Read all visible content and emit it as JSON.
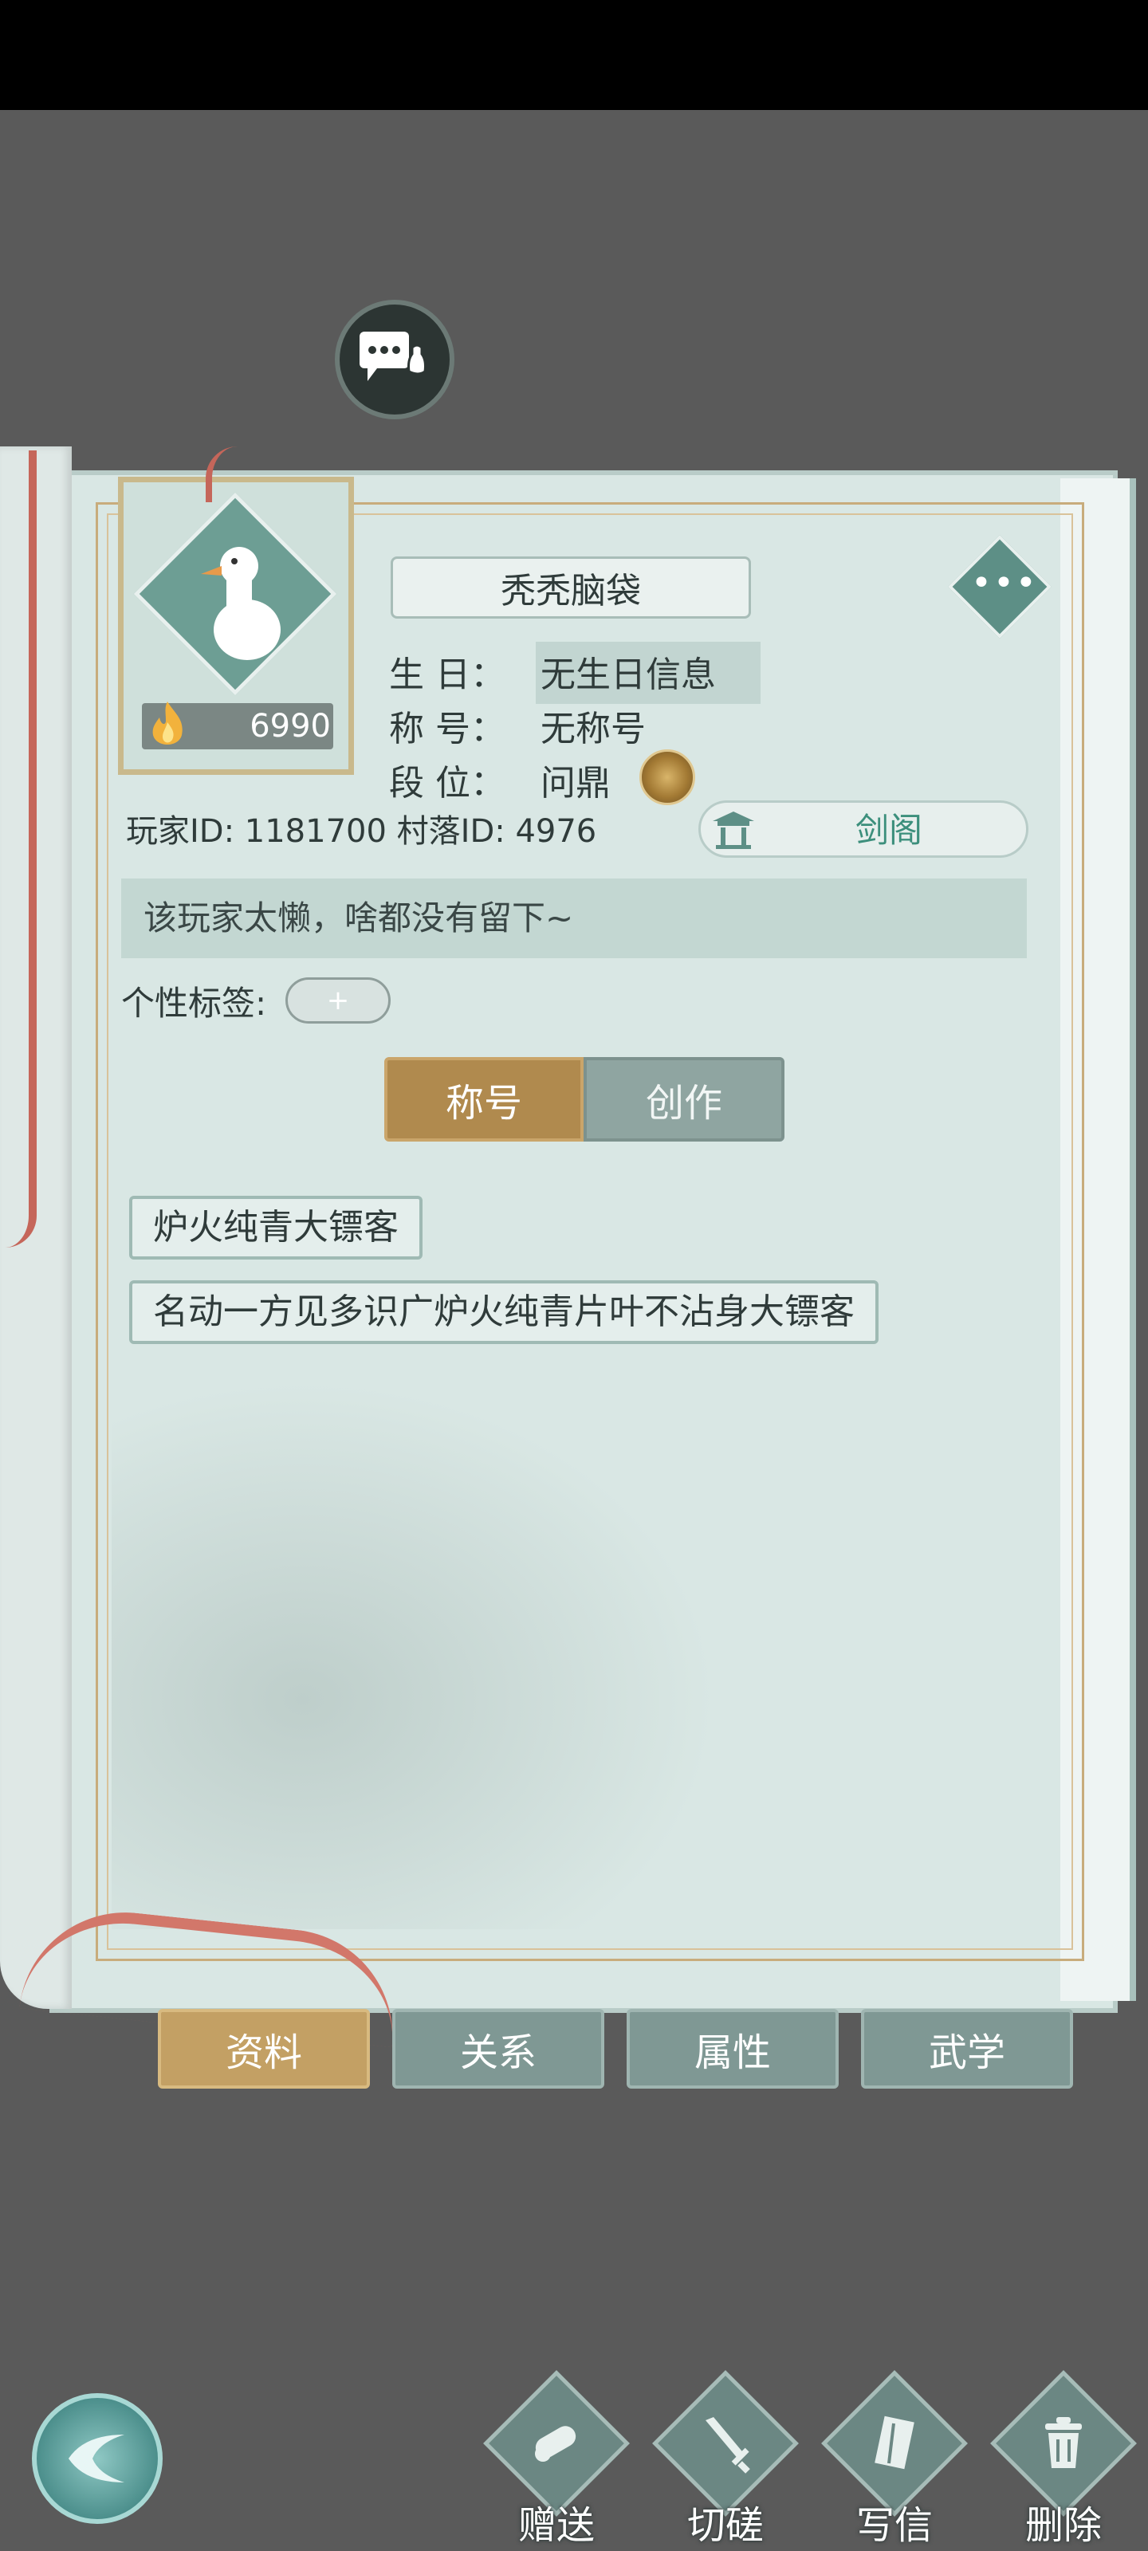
{
  "profile": {
    "name": "秃秃脑袋",
    "fire_value": "6990",
    "birthday_label": "生  日：",
    "birthday_value": "无生日信息",
    "title_label": "称  号：",
    "title_value": "无称号",
    "rank_label": "段  位：",
    "rank_value": "问鼎",
    "player_id_text": "玩家ID: 1181700",
    "village_id_text": "村落ID: 4976",
    "guild": "剑阁",
    "signature": "该玩家太懒，啥都没有留下~",
    "tags_label": "个性标签:",
    "tag_add": "+"
  },
  "segment": {
    "active": "称号",
    "inactive": "创作"
  },
  "titles": [
    "炉火纯青大镖客",
    "名动一方见多识广炉火纯青片叶不沾身大镖客"
  ],
  "tabs": [
    {
      "label": "资料",
      "active": true
    },
    {
      "label": "关系",
      "active": false
    },
    {
      "label": "属性",
      "active": false
    },
    {
      "label": "武学",
      "active": false
    }
  ],
  "actions": [
    {
      "label": "赠送",
      "icon": "scroll-icon"
    },
    {
      "label": "切磋",
      "icon": "sword-icon"
    },
    {
      "label": "写信",
      "icon": "letter-icon"
    },
    {
      "label": "删除",
      "icon": "trash-icon"
    }
  ],
  "more_dots": "•••",
  "colors": {
    "accent_gold": "#b08a4e",
    "accent_teal": "#5d8f86",
    "guild_text": "#3c8f7c"
  }
}
